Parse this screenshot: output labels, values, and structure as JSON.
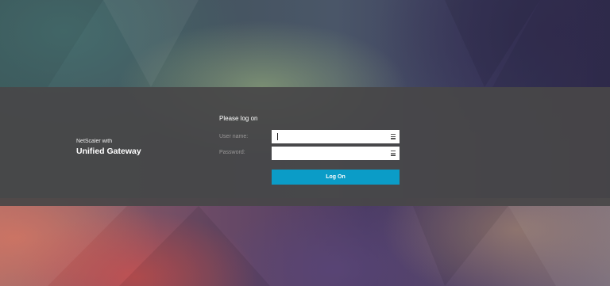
{
  "brand": {
    "line1": "NetScaler with",
    "line2": "Unified Gateway"
  },
  "form": {
    "title": "Please log on",
    "username_label": "User name:",
    "password_label": "Password:",
    "username_value": "",
    "password_value": "",
    "submit_label": "Log On"
  },
  "colors": {
    "accent": "#0b9cc7",
    "band": "#484648"
  }
}
